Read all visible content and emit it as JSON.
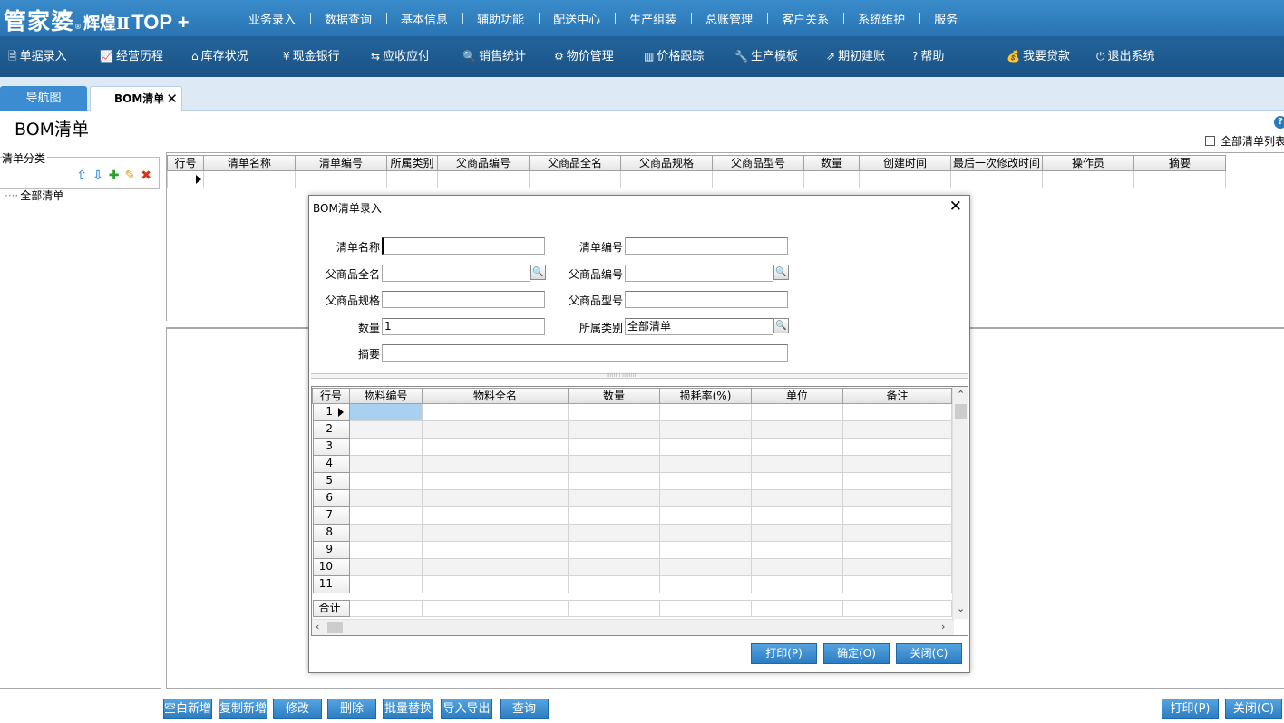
{
  "app": {
    "logo_main": "管家婆",
    "logo_sub": "辉煌Ⅱ",
    "logo_top": "TOP +"
  },
  "top_menu": [
    "业务录入",
    "数据查询",
    "基本信息",
    "辅助功能",
    "配送中心",
    "生产组装",
    "总账管理",
    "客户关系",
    "系统维护",
    "服务"
  ],
  "toolbar": [
    {
      "icon": "document-icon",
      "glyph": "🗎",
      "label": "单据录入"
    },
    {
      "icon": "chart-icon",
      "glyph": "📈",
      "label": "经营历程"
    },
    {
      "icon": "home-icon",
      "glyph": "⌂",
      "label": "库存状况"
    },
    {
      "icon": "yen-icon",
      "glyph": "¥",
      "label": "现金银行"
    },
    {
      "icon": "exchange-icon",
      "glyph": "⇆",
      "label": "应收应付"
    },
    {
      "icon": "search-icon",
      "glyph": "🔍",
      "label": "销售统计"
    },
    {
      "icon": "gear-icon",
      "glyph": "⚙",
      "label": "物价管理"
    },
    {
      "icon": "bar-chart-icon",
      "glyph": "▥",
      "label": "价格跟踪"
    },
    {
      "icon": "wrench-icon",
      "glyph": "🔧",
      "label": "生产模板"
    },
    {
      "icon": "external-link-icon",
      "glyph": "⇗",
      "label": "期初建账"
    },
    {
      "icon": "question-icon",
      "glyph": "?",
      "label": "帮助"
    },
    {
      "icon": "money-bag-icon",
      "glyph": "💰",
      "label": "我要贷款"
    },
    {
      "icon": "power-icon",
      "glyph": "⏻",
      "label": "退出系统"
    }
  ],
  "tabs": [
    {
      "label": "导航图"
    },
    {
      "label": "BOM清单",
      "close": "✕"
    }
  ],
  "page": {
    "title": "BOM清单",
    "help": "?",
    "all_list_label": "全部清单列表"
  },
  "left_panel": {
    "group_label": "清单分类",
    "icons": [
      {
        "name": "move-up-icon",
        "glyph": "⇧",
        "color": "#3d8bd0"
      },
      {
        "name": "move-down-icon",
        "glyph": "⇩",
        "color": "#3d8bd0"
      },
      {
        "name": "add-icon",
        "glyph": "✚",
        "color": "#27a12a"
      },
      {
        "name": "edit-icon",
        "glyph": "✎",
        "color": "#e1a21b"
      },
      {
        "name": "delete-icon",
        "glyph": "✖",
        "color": "#d9301d"
      }
    ],
    "tree_root": "全部清单"
  },
  "main_grid": {
    "columns": [
      "行号",
      "清单名称",
      "清单编号",
      "所属类别",
      "父商品编号",
      "父商品全名",
      "父商品规格",
      "父商品型号",
      "数量",
      "创建时间",
      "最后一次修改时间",
      "操作员",
      "摘要"
    ]
  },
  "bottom_buttons": [
    "空白新增",
    "复制新增",
    "修改",
    "删除",
    "批量替换",
    "导入导出",
    "查询"
  ],
  "bottom_right_buttons": [
    "打印(P)",
    "关闭(C)"
  ],
  "dialog": {
    "title": "BOM清单录入",
    "close": "✕",
    "fields": {
      "list_name": {
        "label": "清单名称",
        "value": ""
      },
      "list_code": {
        "label": "清单编号",
        "value": ""
      },
      "parent_name": {
        "label": "父商品全名",
        "value": ""
      },
      "parent_code": {
        "label": "父商品编号",
        "value": ""
      },
      "parent_spec": {
        "label": "父商品规格",
        "value": ""
      },
      "parent_model": {
        "label": "父商品型号",
        "value": ""
      },
      "quantity": {
        "label": "数量",
        "value": "1"
      },
      "category": {
        "label": "所属类别",
        "value": "全部清单"
      },
      "summary": {
        "label": "摘要",
        "value": ""
      }
    },
    "grid": {
      "columns": [
        "行号",
        "物料编号",
        "物料全名",
        "数量",
        "损耗率(%)",
        "单位",
        "备注"
      ],
      "row_numbers": [
        "1",
        "2",
        "3",
        "4",
        "5",
        "6",
        "7",
        "8",
        "9",
        "10",
        "11"
      ],
      "total_label": "合计"
    },
    "buttons": [
      "打印(P)",
      "确定(O)",
      "关闭(C)"
    ]
  }
}
